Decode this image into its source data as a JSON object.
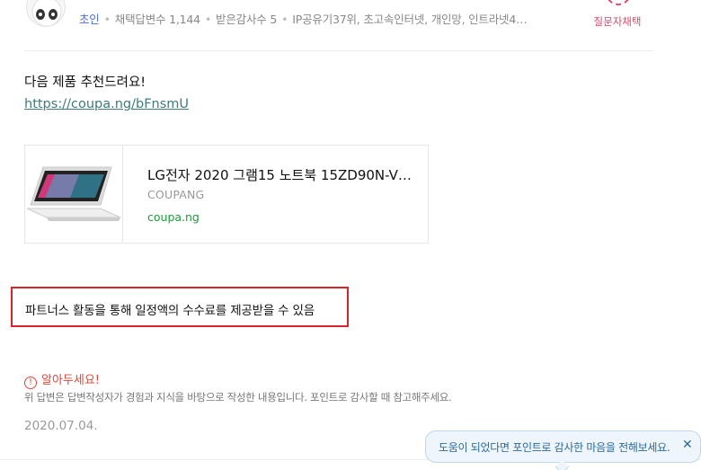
{
  "author": {
    "name": "초인",
    "stats": [
      "채택답변수 1,144",
      "받은감사수 5",
      "IP공유기37위, 초고속인터넷, 개인망, 인트라넷4…"
    ],
    "adopt_label": "질문자채택"
  },
  "answer": {
    "intro": "다음 제품 추천드려요!",
    "link_text": "https://coupa.ng/bFnsmU",
    "product": {
      "title": "LG전자 2020 그램15 노트북 15ZD90N-V…",
      "vendor": "COUPANG",
      "domain": "coupa.ng"
    },
    "partners_notice": "파트너스 활동을 통해 일정액의 수수료를 제공받을 수 있음"
  },
  "notice": {
    "title": "알아두세요!",
    "text": "위 답변은 답변작성자가 경험과 지식을 바탕으로 작성한 내용입니다. 포인트로 감사할 때 참고해주세요."
  },
  "date": "2020.07.04.",
  "tooltip": {
    "text": "도움이 되었다면 포인트로 감사한 마음을 전해보세요.",
    "close_icon": "close-icon"
  },
  "colors": {
    "accent_red": "#e0463a",
    "partners_border": "#d8232a",
    "link": "#3f7a7a",
    "domain_green": "#1f9a3a",
    "tooltip_text": "#2a6aa0"
  }
}
